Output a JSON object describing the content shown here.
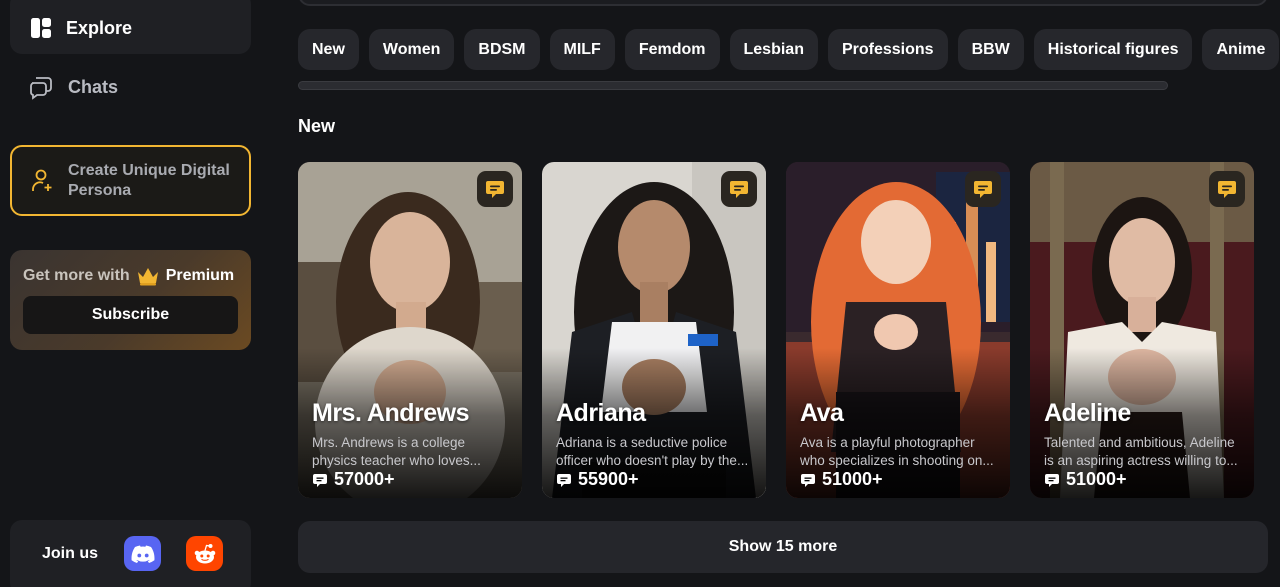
{
  "sidebar": {
    "explore_label": "Explore",
    "chats_label": "Chats",
    "persona_label": "Create Unique Digital Persona",
    "premium": {
      "prefix": "Get more with",
      "name": "Premium",
      "subscribe_label": "Subscribe"
    },
    "join": {
      "label": "Join us",
      "discord_color": "#5865f2",
      "reddit_color": "#ff4500"
    }
  },
  "categories": [
    "New",
    "Women",
    "BDSM",
    "MILF",
    "Femdom",
    "Lesbian",
    "Professions",
    "BBW",
    "Historical figures",
    "Anime"
  ],
  "section_title": "New",
  "cards": [
    {
      "name": "Mrs. Andrews",
      "description": "Mrs. Andrews is a college physics teacher who loves...",
      "count": "57000+"
    },
    {
      "name": "Adriana",
      "description": "Adriana is a seductive police officer who doesn't play by the...",
      "count": "55900+"
    },
    {
      "name": "Ava",
      "description": "Ava is a playful photographer who specializes in shooting on...",
      "count": "51000+"
    },
    {
      "name": "Adeline",
      "description": "Talented and ambitious, Adeline is an aspiring actress willing to...",
      "count": "51000+"
    }
  ],
  "show_more_label": "Show 15 more",
  "colors": {
    "accent": "#f2b632",
    "background": "#141518",
    "panel": "#1f2024",
    "chip": "#26272c"
  }
}
